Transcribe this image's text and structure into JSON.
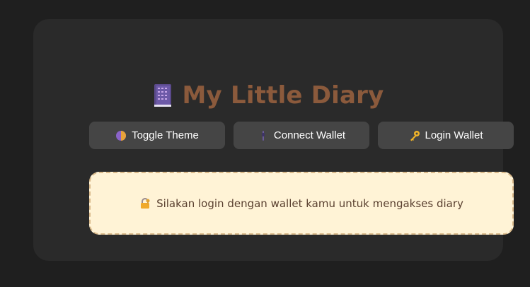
{
  "header": {
    "title": "My Little Diary",
    "icon": "notebook-icon",
    "title_color": "#8b5a3c"
  },
  "buttons": {
    "toggle_theme": {
      "label": "Toggle Theme",
      "icon": "half-circle-icon"
    },
    "connect_wallet": {
      "label": "Connect Wallet",
      "icon": "plug-icon"
    },
    "login_wallet": {
      "label": "Login Wallet",
      "icon": "key-icon"
    }
  },
  "notice": {
    "text": "Silakan login dengan wallet kamu untuk mengakses diary",
    "icon": "lock-key-icon"
  },
  "colors": {
    "page_bg": "#1f1f1f",
    "card_bg": "#2a2a2a",
    "button_bg": "#454545",
    "notice_bg": "#fff3d6",
    "notice_border": "#d9b98a"
  }
}
